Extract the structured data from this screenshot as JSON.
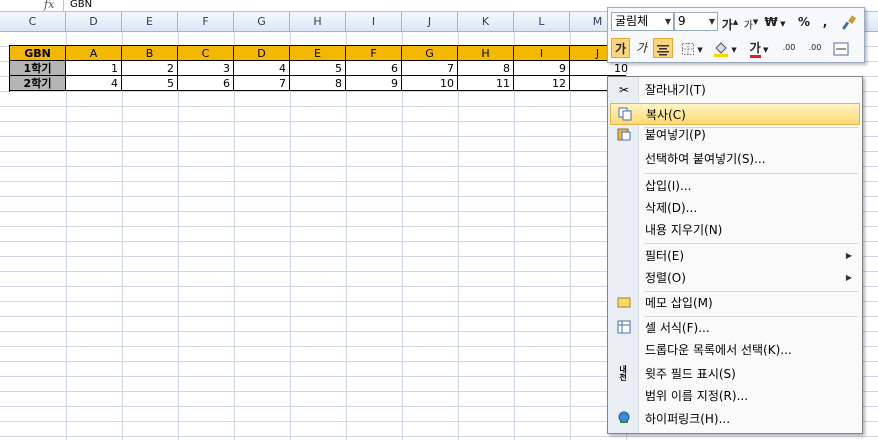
{
  "formula_bar": {
    "fx": "fx",
    "value": "GBN"
  },
  "columns": [
    "C",
    "D",
    "E",
    "F",
    "G",
    "H",
    "I",
    "J",
    "K",
    "L",
    "M"
  ],
  "table": {
    "header": [
      "GBN",
      "A",
      "B",
      "C",
      "D",
      "E",
      "F",
      "G",
      "H",
      "I",
      "J"
    ],
    "rows": [
      {
        "label": "1학기",
        "values": [
          "1",
          "2",
          "3",
          "4",
          "5",
          "6",
          "7",
          "8",
          "9",
          "10"
        ]
      },
      {
        "label": "2학기",
        "values": [
          "4",
          "5",
          "6",
          "7",
          "8",
          "9",
          "10",
          "11",
          "12",
          ""
        ]
      }
    ]
  },
  "mini_toolbar": {
    "font_name": "굴림체",
    "font_size": "9",
    "grow_font": "가",
    "shrink_font": "가",
    "currency": "₩",
    "percent": "%",
    "comma": ",",
    "bold": "가",
    "italic": "가",
    "font_color_label": "가",
    "inc_decimal": ".00",
    "dec_decimal": ".00",
    "accent_red": "#e31b1b",
    "accent_yellow": "#f5d400"
  },
  "context_menu": {
    "items": [
      {
        "label": "잘라내기(T)",
        "icon": "scissors-icon"
      },
      {
        "label": "복사(C)",
        "icon": "copy-icon"
      },
      {
        "label": "붙여넣기(P)",
        "icon": "paste-icon"
      },
      {
        "label": "선택하여 붙여넣기(S)...",
        "icon": ""
      },
      {
        "label": "삽입(I)...",
        "icon": ""
      },
      {
        "label": "삭제(D)...",
        "icon": ""
      },
      {
        "label": "내용 지우기(N)",
        "icon": ""
      },
      {
        "label": "필터(E)",
        "icon": ""
      },
      {
        "label": "정렬(O)",
        "icon": ""
      },
      {
        "label": "메모 삽입(M)",
        "icon": "memo-icon"
      },
      {
        "label": "셀 서식(F)...",
        "icon": "format-cells-icon"
      },
      {
        "label": "드롭다운 목록에서 선택(K)...",
        "icon": ""
      },
      {
        "label": "윗주 필드 표시(S)",
        "icon": "phonetic-icon"
      },
      {
        "label": "범위 이름 지정(R)...",
        "icon": ""
      },
      {
        "label": "하이퍼링크(H)...",
        "icon": "hyperlink-icon"
      }
    ],
    "phonetic_icon_text": "내천",
    "highlighted_index": 1
  }
}
